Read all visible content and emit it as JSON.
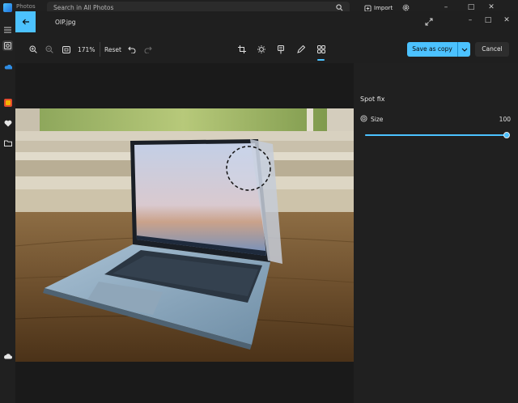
{
  "app": {
    "title": "Photos",
    "search_placeholder": "Search in All Photos",
    "import_label": "Import"
  },
  "editor": {
    "file_name": "OIP.jpg",
    "zoom_level": "171%",
    "reset_label": "Reset",
    "save_as_copy_label": "Save as copy",
    "cancel_label": "Cancel"
  },
  "panel": {
    "title": "Spot fix",
    "size_label": "Size",
    "size_value": "100",
    "size_fraction": 1.0
  },
  "colors": {
    "accent": "#4cc2ff",
    "background": "#1f1f1f",
    "panel": "#202020"
  },
  "icons": {
    "rail": [
      "menu-icon",
      "gallery-icon",
      "onedrive-icon",
      "apps-icon",
      "heart-icon",
      "folder-icon",
      "cloud-icon"
    ],
    "toolbar": [
      "zoom-in-icon",
      "zoom-out-icon",
      "fit-icon",
      "undo-icon",
      "redo-icon",
      "crop-icon",
      "adjust-icon",
      "filter-icon",
      "markup-icon",
      "spot-fix-icon"
    ]
  }
}
